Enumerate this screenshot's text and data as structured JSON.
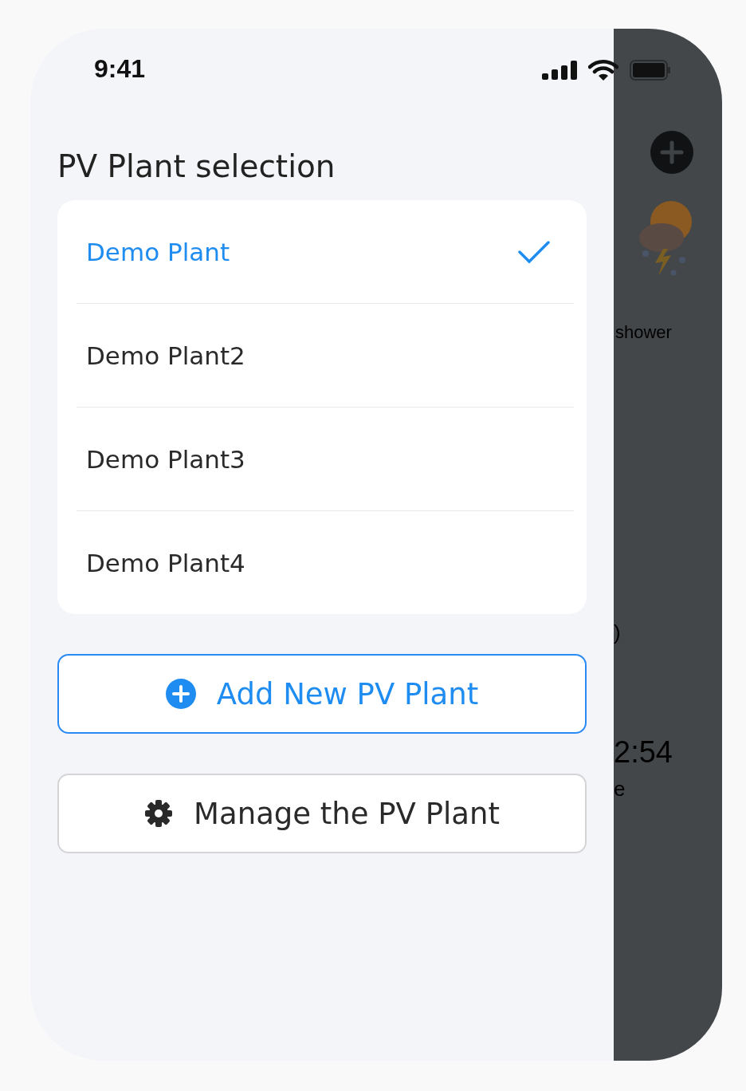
{
  "status_bar": {
    "time": "9:41"
  },
  "title": "PV Plant selection",
  "plants": [
    {
      "name": "Demo Plant",
      "selected": true
    },
    {
      "name": "Demo Plant2",
      "selected": false
    },
    {
      "name": "Demo Plant3",
      "selected": false
    },
    {
      "name": "Demo Plant4",
      "selected": false
    }
  ],
  "buttons": [
    {
      "kind": "add",
      "label": "Add New PV Plant"
    },
    {
      "kind": "manage",
      "label": "Manage the PV Plant"
    }
  ],
  "background": {
    "weather_label": "shower",
    "fragment": ")",
    "time": "2:54",
    "caption": "e"
  }
}
